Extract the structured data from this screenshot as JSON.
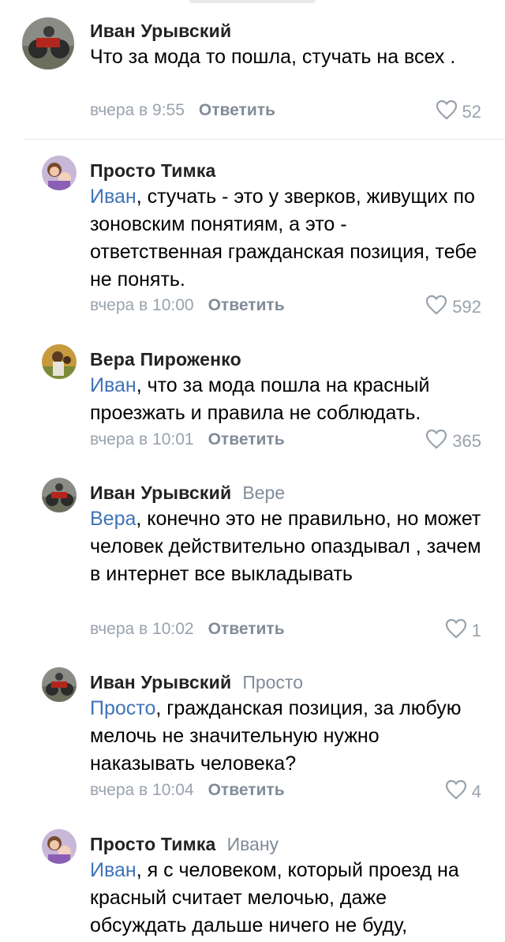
{
  "comments": [
    {
      "author": "Иван Урывский",
      "reply_to": "",
      "mention": "",
      "text": "Что за мода то пошла,  стучать на всех .",
      "time": "вчера в 9:55",
      "reply_label": "Ответить",
      "likes": "52"
    },
    {
      "author": "Просто Тимка",
      "reply_to": "",
      "mention": "Иван",
      "text": ", стучать - это у зверков, живущих по зоновским понятиям, а это - ответственная гражданская позиция, тебе не понять.",
      "time": "вчера в 10:00",
      "reply_label": "Ответить",
      "likes": "592"
    },
    {
      "author": "Вера Пироженко",
      "reply_to": "",
      "mention": "Иван",
      "text": ", что за мода пошла на красный проезжать  и правила не соблюдать.",
      "time": "вчера в 10:01",
      "reply_label": "Ответить",
      "likes": "365"
    },
    {
      "author": "Иван Урывский",
      "reply_to": "Вере",
      "mention": "Вера",
      "text": ", конечно это не правильно, но может человек действительно опаздывал , зачем в интернет все выкладывать",
      "time": "вчера в 10:02",
      "reply_label": "Ответить",
      "likes": "1"
    },
    {
      "author": "Иван Урывский",
      "reply_to": "Просто",
      "mention": "Просто",
      "text": ", гражданская позиция,  за любую мелочь  не значительную нужно наказывать человека?",
      "time": "вчера в 10:04",
      "reply_label": "Ответить",
      "likes": "4"
    },
    {
      "author": "Просто Тимка",
      "reply_to": "Ивану",
      "mention": "Иван",
      "text": ", я с человеком, который проезд на красный считает мелочью, даже обсуждать дальше ничего не буду,",
      "time": "",
      "reply_label": "",
      "likes": ""
    }
  ],
  "colors": {
    "mention": "#3f73b8",
    "meta": "#99a2ad",
    "reply": "#818c99"
  },
  "icons": {
    "like": "heart-outline-icon"
  }
}
